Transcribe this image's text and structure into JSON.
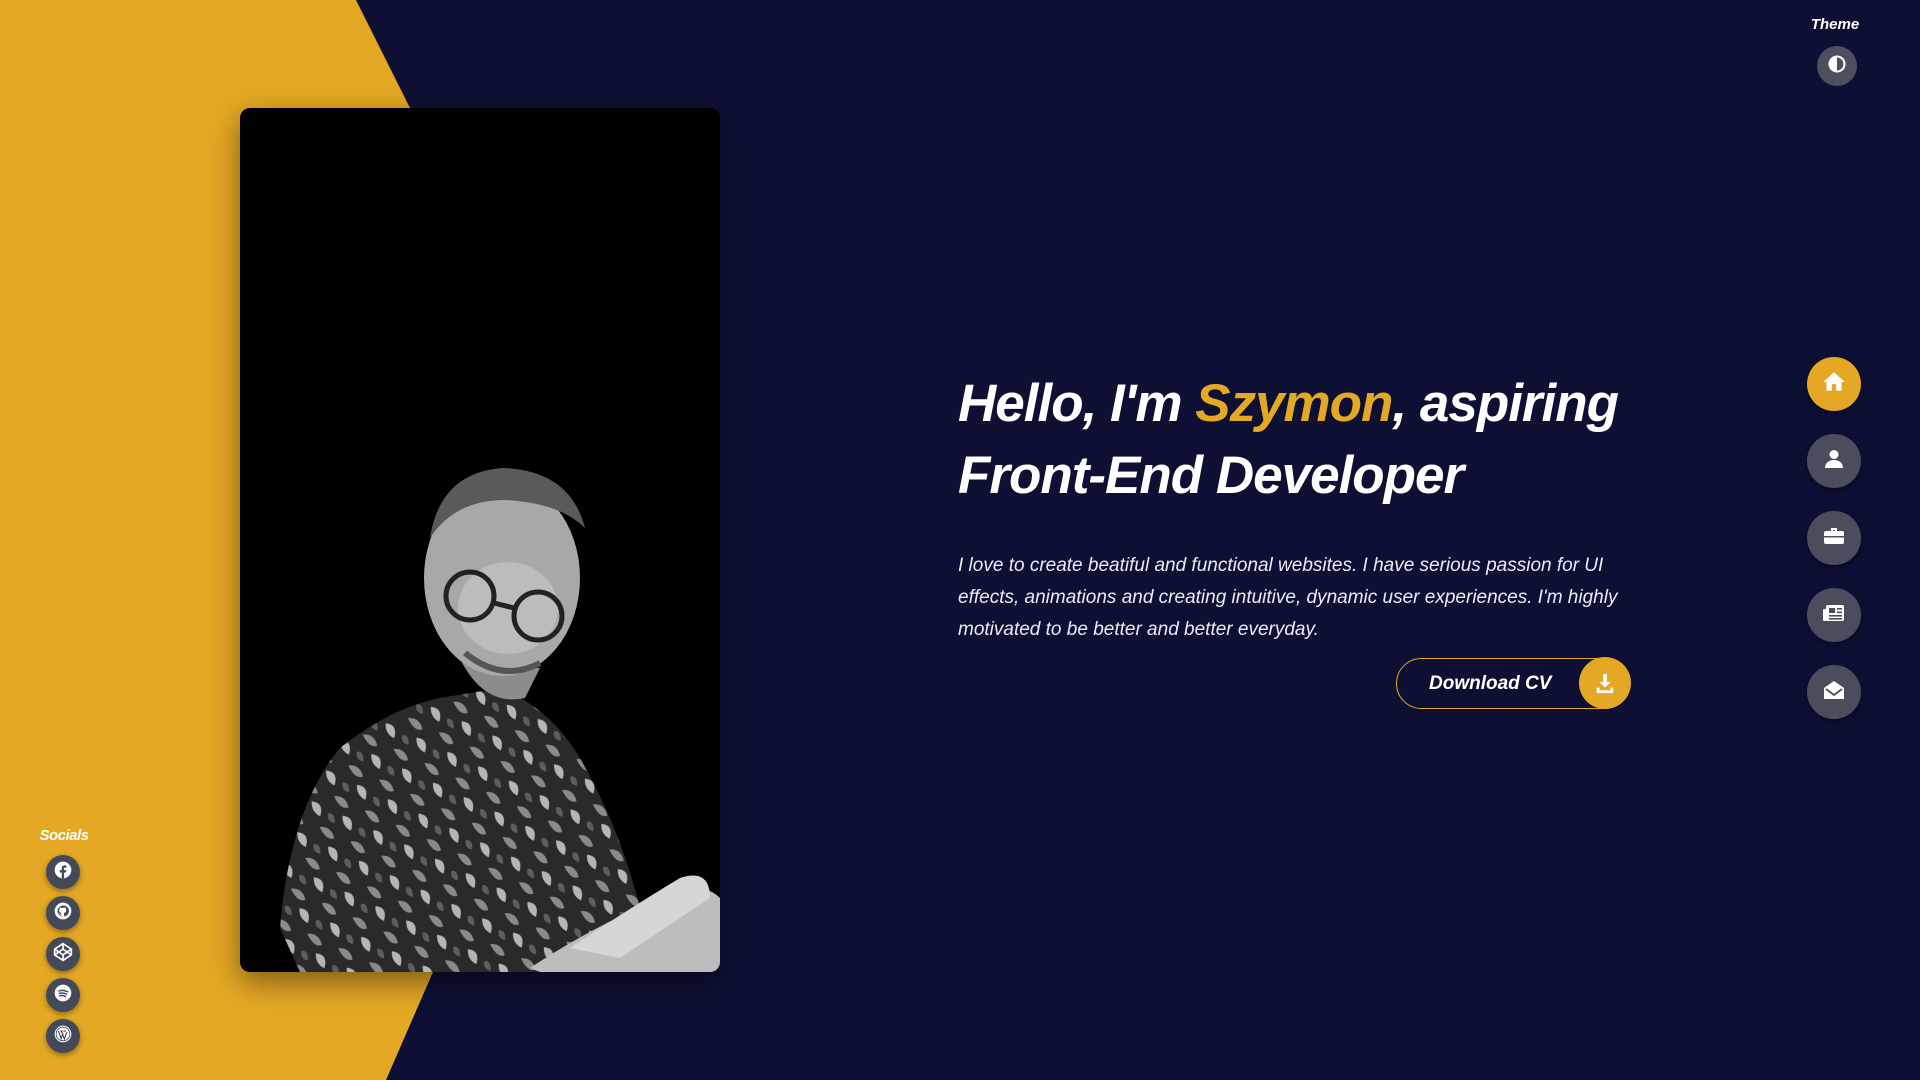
{
  "theme": {
    "label": "Theme",
    "toggle_icon": "contrast-icon"
  },
  "hero": {
    "title_prefix": "Hello, I'm ",
    "name": "Szymon",
    "title_suffix_line1": ", aspiring",
    "title_line2": "Front-End Developer",
    "description": "I love to create beatiful and functional websites. I have serious passion for UI effects, animations and creating intuitive, dynamic user experiences. I'm highly motivated to be better and better everyday.",
    "cv_button_label": "Download CV",
    "cv_button_icon": "download-icon"
  },
  "nav": {
    "items": [
      {
        "icon": "home-icon",
        "active": true
      },
      {
        "icon": "user-icon",
        "active": false
      },
      {
        "icon": "briefcase-icon",
        "active": false
      },
      {
        "icon": "newspaper-icon",
        "active": false
      },
      {
        "icon": "envelope-open-icon",
        "active": false
      }
    ]
  },
  "socials": {
    "label": "Socials",
    "items": [
      "facebook-icon",
      "github-icon",
      "codepen-icon",
      "spotify-icon",
      "wordpress-icon"
    ]
  },
  "colors": {
    "background": "#0d1033",
    "accent": "#e4a824",
    "icon_button": "#4a4e5c",
    "text": "#ffffff"
  }
}
